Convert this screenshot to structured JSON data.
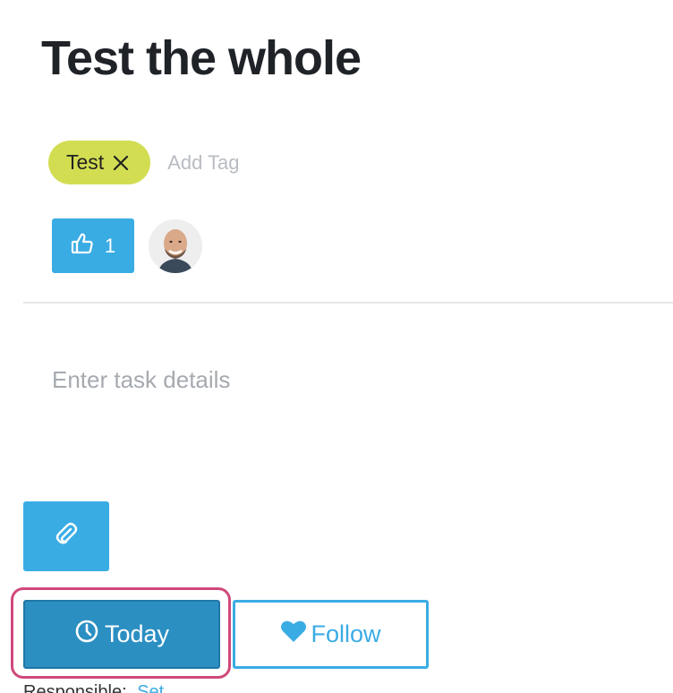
{
  "task": {
    "title": "Test the whole",
    "details_placeholder": "Enter task details"
  },
  "tags": {
    "items": [
      {
        "label": "Test"
      }
    ],
    "add_label": "Add Tag",
    "chip_color": "#d2dd52"
  },
  "likes": {
    "count": "1",
    "icon": "thumbs-up-icon"
  },
  "attachment": {
    "icon": "paperclip-icon"
  },
  "actions": {
    "today_label": "Today",
    "today_icon": "clock-icon",
    "follow_label": "Follow",
    "follow_icon": "heart-icon"
  },
  "responsible": {
    "label": "Responsible:",
    "value": "Set"
  },
  "colors": {
    "accent": "#3aace4",
    "today_bg": "#2b8fc2",
    "highlight": "#d0487c"
  }
}
